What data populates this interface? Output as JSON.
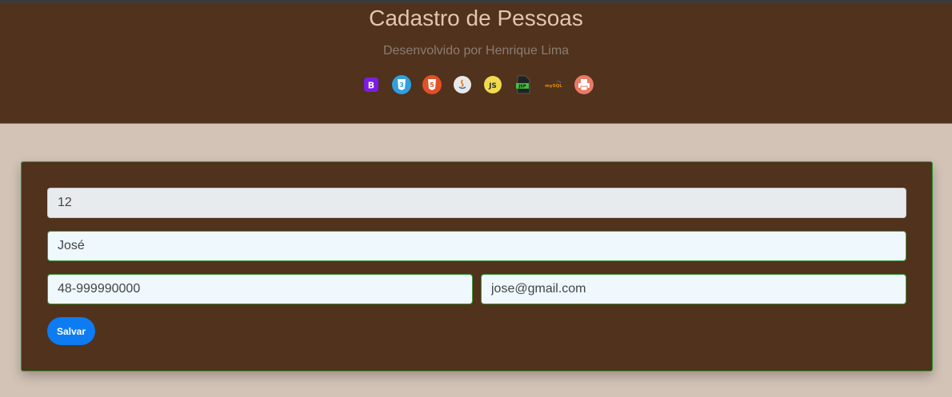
{
  "header": {
    "title": "Cadastro de Pessoas",
    "subtitle": "Desenvolvido por Henrique Lima",
    "tech_icons": [
      "bootstrap-icon",
      "css3-icon",
      "html5-icon",
      "java-icon",
      "javascript-icon",
      "jsp-icon",
      "mysql-icon",
      "print-icon"
    ]
  },
  "form": {
    "id_value": "12",
    "name_value": "José",
    "phone_value": "48-999990000",
    "email_value": "jose@gmail.com",
    "save_label": "Salvar"
  },
  "colors": {
    "header_bg": "#50321d",
    "page_bg": "#d2c3b6",
    "button": "#0d7cf2",
    "border_accent": "#2f9a2f"
  }
}
